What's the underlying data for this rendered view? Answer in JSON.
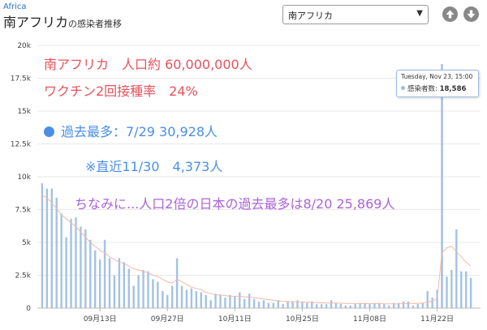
{
  "header": {
    "breadcrumb": "Africa",
    "title": "南アフリカ",
    "title_suffix": "の感染者推移",
    "region_select": "南アフリカ"
  },
  "buttons": {
    "up_icon": "arrow-up-circle-icon",
    "down_icon": "arrow-down-circle-icon"
  },
  "tooltip": {
    "date": "Tuesday, Nov 23, 15:00",
    "label": "感染者数",
    "value": "18,586"
  },
  "annotations": {
    "line1": "南アフリカ　人口約 60,000,000人",
    "line2": "ワクチン2回接種率　24%",
    "line3": "過去最多：7/29 30,928人",
    "line4": "※直近11/30　4,373人",
    "line5": "ちなみに...人口2倍の日本の過去最多は8/20 25,869人"
  },
  "colors": {
    "bar": "#a4c2e4",
    "highlight": "#9fbde1",
    "ma_line": "#f5b8a8",
    "red": "#e6525c",
    "blue": "#4a8ee8",
    "purple": "#a964d9"
  },
  "chart_data": {
    "type": "bar",
    "x_start": "2021-09-01",
    "x_end": "2021-11-30",
    "xtick_labels": [
      "09月13日",
      "09月27日",
      "10月11日",
      "10月25日",
      "11月08日",
      "11月22日"
    ],
    "xtick_dates": [
      "2021-09-13",
      "2021-09-27",
      "2021-10-11",
      "2021-10-25",
      "2021-11-08",
      "2021-11-22"
    ],
    "ylim": [
      0,
      20000
    ],
    "yticks": [
      0,
      2500,
      5000,
      7500,
      10000,
      12500,
      15000,
      17500,
      20000
    ],
    "ytick_labels": [
      "0",
      "2.5k",
      "5k",
      "7.5k",
      "10k",
      "12.5k",
      "15k",
      "17.5k",
      "20k"
    ],
    "grid": true,
    "highlight_index": 83,
    "values": [
      9500,
      9100,
      9100,
      8400,
      7200,
      5400,
      6800,
      6900,
      6200,
      6000,
      5200,
      4400,
      3700,
      5200,
      3800,
      2500,
      3800,
      3500,
      3000,
      1700,
      2500,
      2900,
      2800,
      2200,
      2000,
      1300,
      1000,
      1700,
      3800,
      1700,
      1400,
      1500,
      1300,
      1200,
      1000,
      600,
      1100,
      1000,
      800,
      1000,
      900,
      1200,
      700,
      1100,
      700,
      500,
      600,
      400,
      400,
      600,
      300,
      500,
      500,
      600,
      500,
      400,
      500,
      300,
      300,
      300,
      600,
      400,
      300,
      200,
      200,
      300,
      400,
      400,
      300,
      400,
      400,
      300,
      200,
      400,
      400,
      500,
      500,
      200,
      300,
      400,
      1300,
      800,
      1400,
      18586,
      2400,
      2900,
      6000,
      2800,
      2800,
      2300
    ],
    "moving_average": [
      8600,
      8400,
      8000,
      7600,
      7100,
      6800,
      6500,
      6200,
      5800,
      5400,
      5000,
      4700,
      4400,
      4200,
      3900,
      3700,
      3500,
      3400,
      3200,
      3000,
      2900,
      2800,
      2700,
      2500,
      2400,
      2200,
      2000,
      1900,
      2200,
      2000,
      1800,
      1600,
      1500,
      1400,
      1200,
      1100,
      1000,
      1000,
      950,
      900,
      900,
      900,
      850,
      850,
      800,
      750,
      700,
      650,
      600,
      550,
      500,
      500,
      500,
      480,
      470,
      450,
      430,
      410,
      400,
      390,
      390,
      380,
      370,
      360,
      350,
      340,
      340,
      340,
      340,
      340,
      340,
      330,
      320,
      320,
      330,
      340,
      350,
      350,
      360,
      380,
      450,
      550,
      700,
      4200,
      4600,
      4700,
      4300,
      3900,
      3500,
      3200
    ]
  }
}
